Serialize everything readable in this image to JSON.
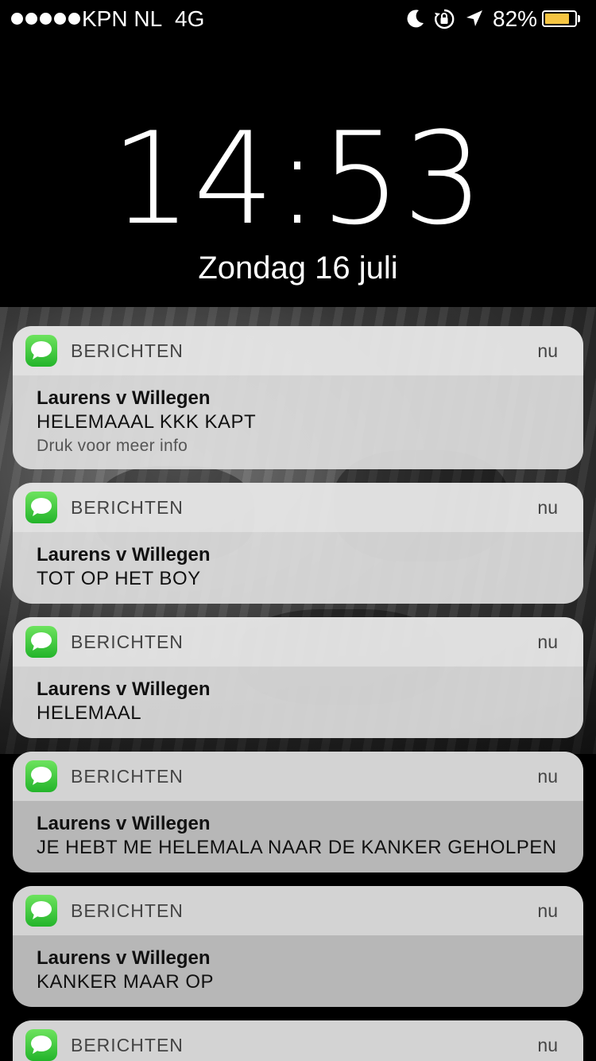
{
  "status_bar": {
    "carrier": "KPN NL",
    "network": "4G",
    "battery_percent": "82%",
    "battery_level": 0.82,
    "battery_color": "#f5c542",
    "icons": [
      "signal-dots",
      "moon-icon",
      "rotation-lock-icon",
      "location-arrow-icon",
      "battery-icon"
    ]
  },
  "lock_screen": {
    "time": "14:53",
    "date": "Zondag 16 juli"
  },
  "notifications": [
    {
      "app": "BERICHTEN",
      "time": "nu",
      "sender": "Laurens v Willegen",
      "message": "HELEMAAAL KKK KAPT",
      "hint": "Druk voor meer info"
    },
    {
      "app": "BERICHTEN",
      "time": "nu",
      "sender": "Laurens v Willegen",
      "message": "TOT OP HET BOY"
    },
    {
      "app": "BERICHTEN",
      "time": "nu",
      "sender": "Laurens v Willegen",
      "message": "HELEMAAL"
    },
    {
      "app": "BERICHTEN",
      "time": "nu",
      "sender": "Laurens v Willegen",
      "message": "JE HEBT ME HELEMALA NAAR DE KANKER GEHOLPEN"
    },
    {
      "app": "BERICHTEN",
      "time": "nu",
      "sender": "Laurens v Willegen",
      "message": "KANKER MAAR OP"
    },
    {
      "app": "BERICHTEN",
      "time": "nu"
    }
  ],
  "colors": {
    "messages_icon_green": "#34c43a"
  }
}
